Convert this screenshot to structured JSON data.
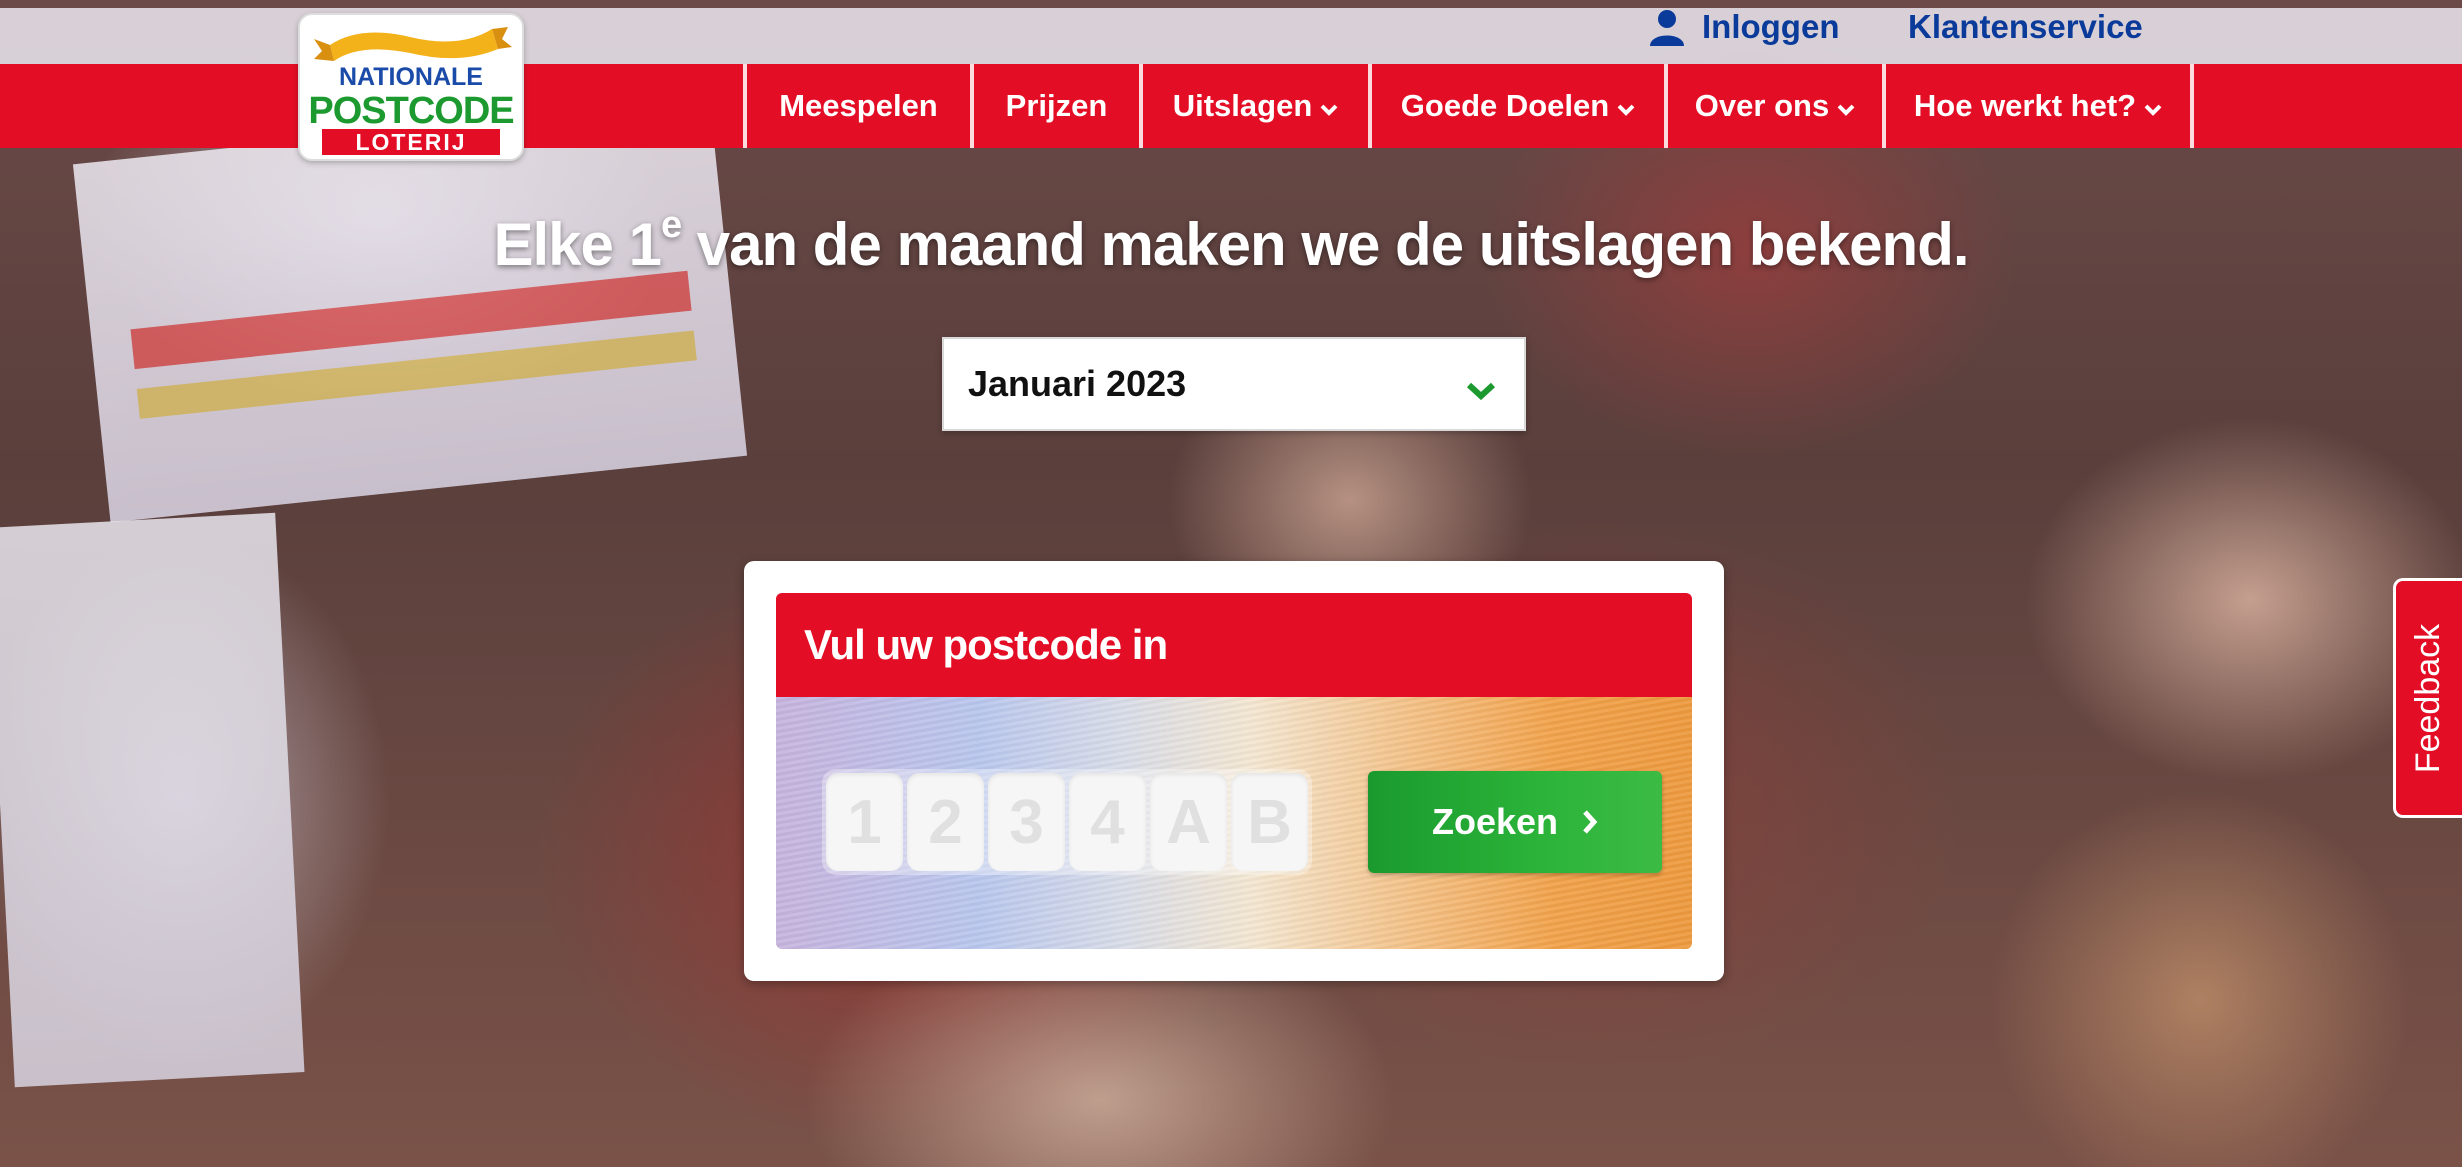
{
  "header": {
    "login_label": "Inloggen",
    "service_label": "Klantenservice",
    "logo": {
      "line1": "NATIONALE",
      "line2": "POSTCODE",
      "line3": "LOTERIJ"
    }
  },
  "nav": {
    "items": [
      {
        "label": "Meespelen",
        "has_dropdown": false
      },
      {
        "label": "Prijzen",
        "has_dropdown": false
      },
      {
        "label": "Uitslagen",
        "has_dropdown": true
      },
      {
        "label": "Goede Doelen",
        "has_dropdown": true
      },
      {
        "label": "Over ons",
        "has_dropdown": true
      },
      {
        "label": "Hoe werkt het?",
        "has_dropdown": true
      }
    ]
  },
  "hero": {
    "headline_part1": "Elke 1",
    "headline_sup": "e",
    "headline_part2": " van de maand maken we de uitslagen bekend.",
    "month_select_value": "Januari 2023"
  },
  "postcode_card": {
    "title": "Vul uw postcode in",
    "placeholder_chars": [
      "1",
      "2",
      "3",
      "4",
      "A",
      "B"
    ],
    "search_label": "Zoeken"
  },
  "feedback_label": "Feedback",
  "colors": {
    "brand_red": "#e30e25",
    "link_blue": "#0a3a9a",
    "button_green": "#2cb43a",
    "chevron_green": "#1c9a2f"
  }
}
